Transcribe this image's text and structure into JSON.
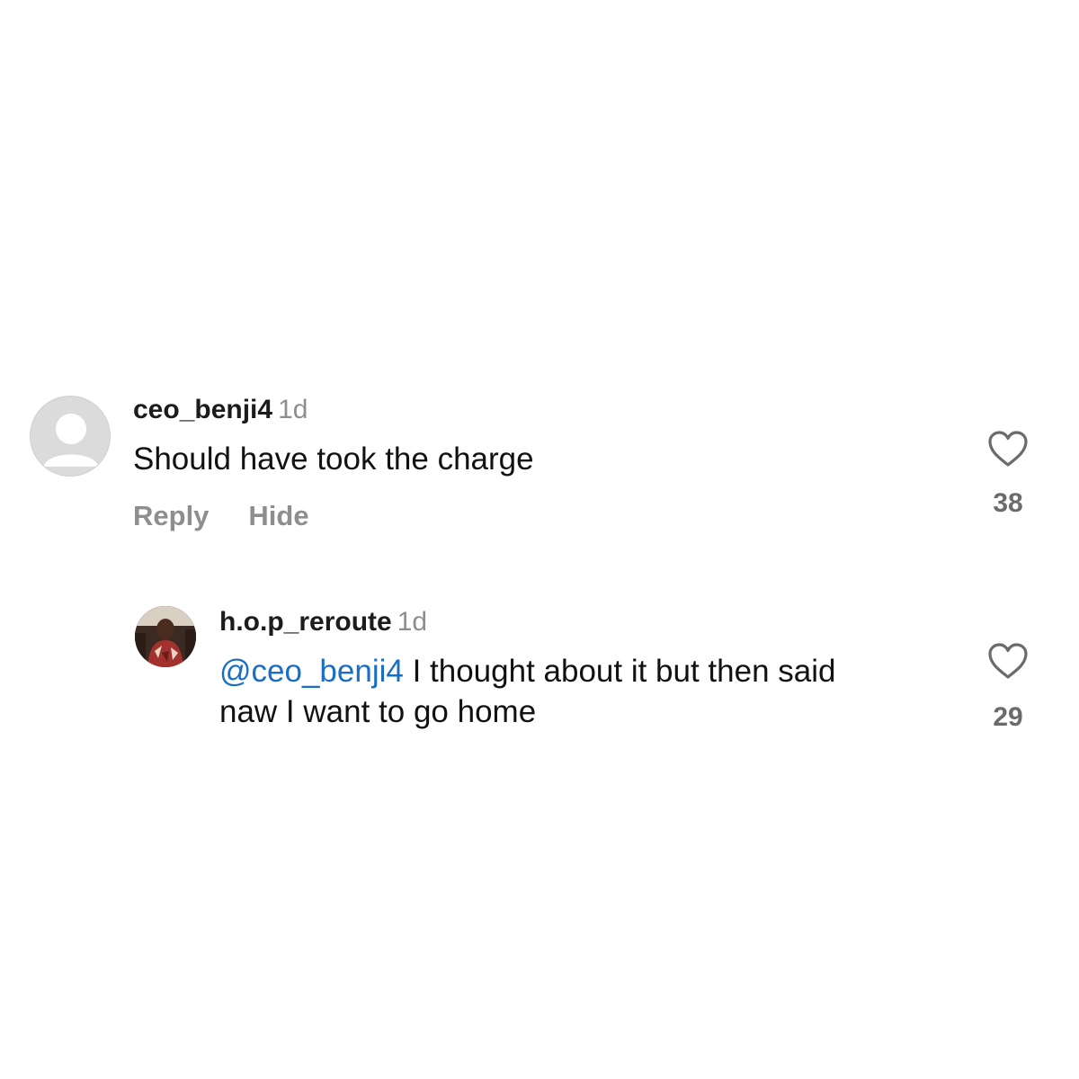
{
  "comments": [
    {
      "username": "ceo_benji4",
      "time": "1d",
      "text": "Should have took the charge",
      "actions": {
        "reply": "Reply",
        "hide": "Hide"
      },
      "likes": "38",
      "avatar": "default-avatar-icon"
    },
    {
      "username": "h.o.p_reroute",
      "time": "1d",
      "mention": "@ceo_benji4",
      "text_line1": " I thought about it but then said",
      "text_line2": "naw I want to go home",
      "likes": "29",
      "avatar": "user-photo"
    }
  ],
  "colors": {
    "mention": "#1a6fc4",
    "secondary_text": "#8e8e8e",
    "primary_text": "#111111"
  }
}
